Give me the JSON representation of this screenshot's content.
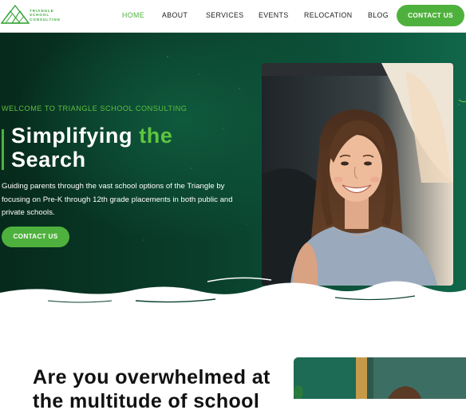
{
  "header": {
    "logo_lines": [
      "TRIANGLE",
      "SCHOOL",
      "CONSULTING"
    ],
    "nav": [
      "HOME",
      "ABOUT",
      "SERVICES",
      "EVENTS",
      "RELOCATION",
      "BLOG"
    ],
    "active_nav": "HOME",
    "cta_label": "CONTACT US"
  },
  "hero": {
    "welcome": "WELCOME TO TRIANGLE SCHOOL CONSULTING",
    "title_part1": "Simplifying ",
    "title_highlight": "the",
    "title_part2": "Search",
    "description": "Guiding parents through the vast school options of the Triangle by focusing on Pre-K through 12th grade placements in both public and private schools.",
    "button_label": "CONTACT US"
  },
  "section2": {
    "heading_line1": "Are you overwhelmed at",
    "heading_line2": "the multitude of school"
  },
  "colors": {
    "accent": "#4fb13d",
    "hero_dark": "#062a1c",
    "hero_light": "#11674a",
    "text_dark": "#111111"
  },
  "icons": [
    "triangle-logo-icon",
    "photo-woman-smiling",
    "brush-wave-divider"
  ]
}
